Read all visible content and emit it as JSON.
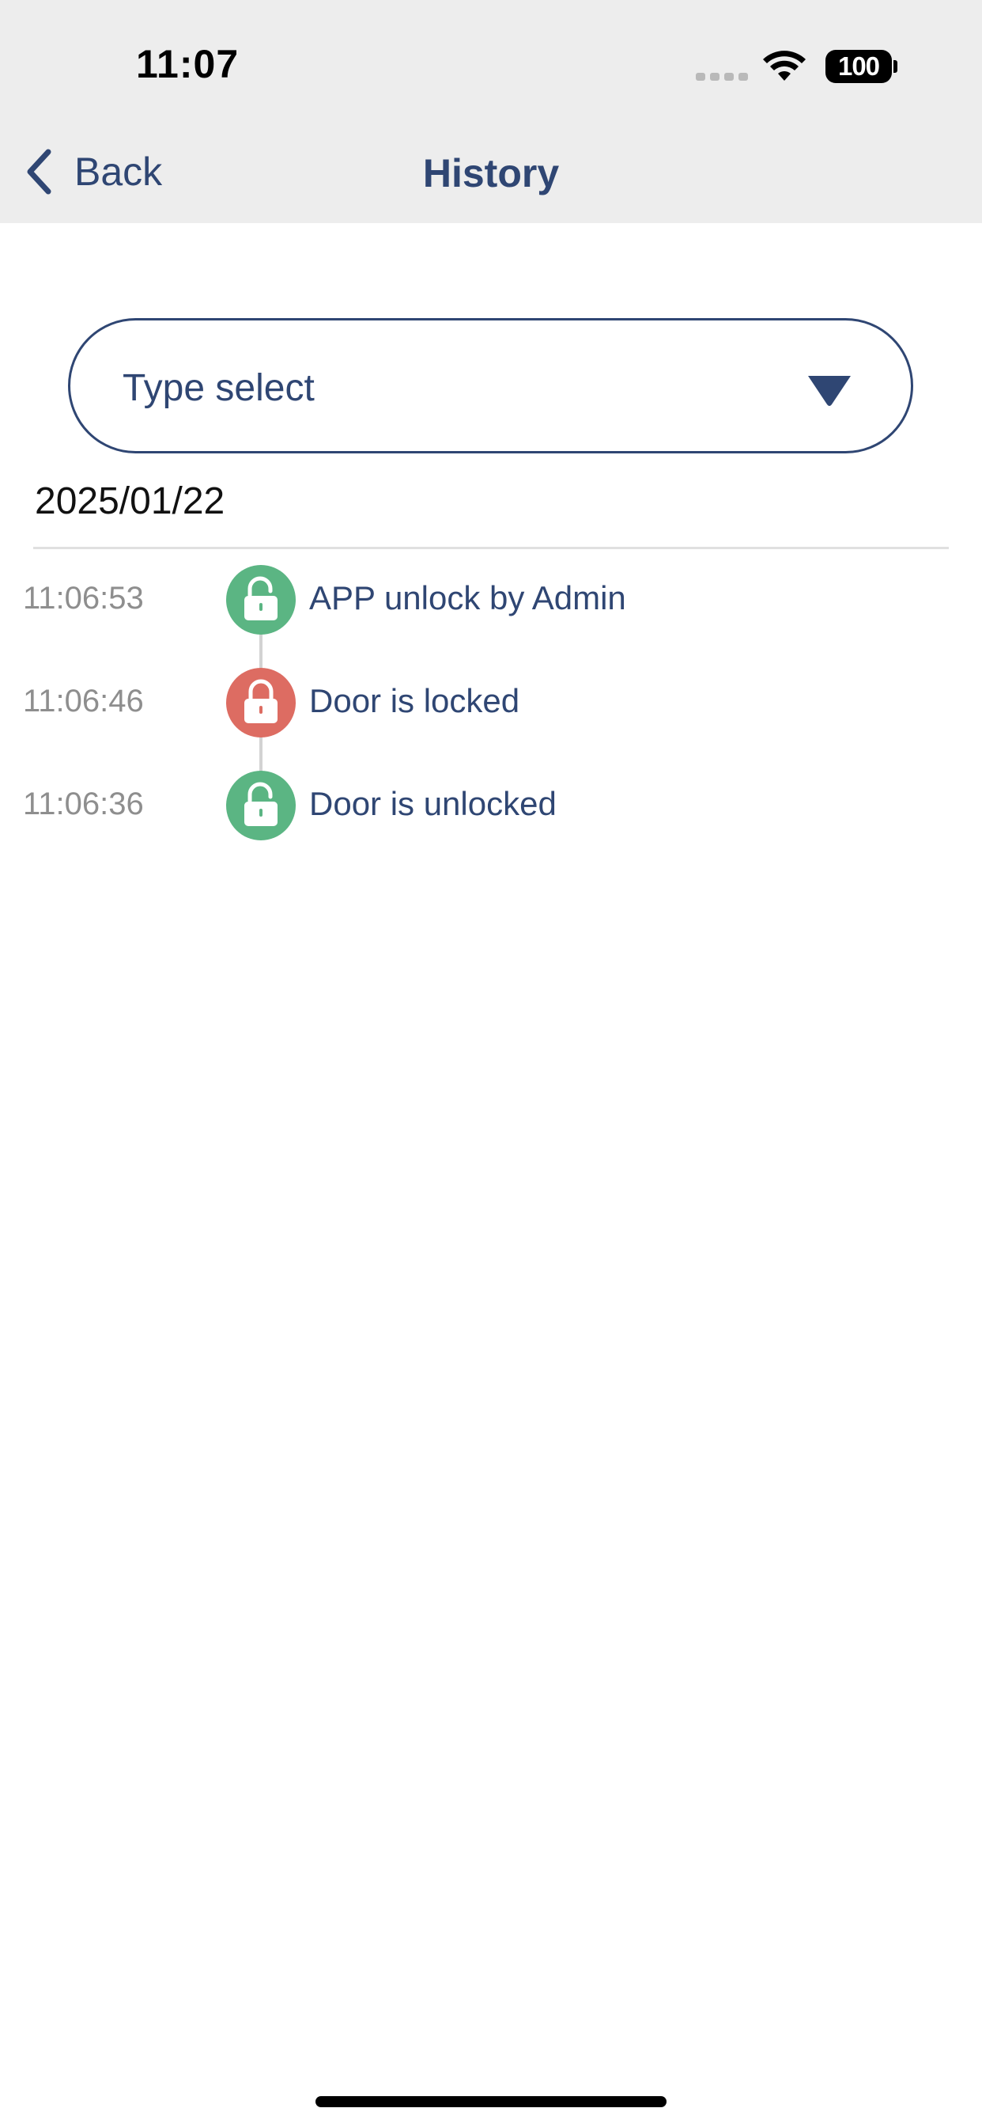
{
  "status_bar": {
    "time": "11:07",
    "battery": "100",
    "icons": [
      "signal-icon",
      "wifi-icon",
      "battery-icon"
    ]
  },
  "nav": {
    "back_label": "Back",
    "title": "History"
  },
  "filter": {
    "placeholder": "Type select"
  },
  "date": "2025/01/22",
  "colors": {
    "accent": "#2f4673",
    "unlocked": "#5bb583",
    "locked": "#dd6c62",
    "topbar_bg": "#ededed"
  },
  "events": [
    {
      "time": "11:06:53",
      "text": "APP unlock by Admin",
      "state": "unlocked",
      "icon": "unlock-icon"
    },
    {
      "time": "11:06:46",
      "text": "Door is locked",
      "state": "locked",
      "icon": "lock-icon"
    },
    {
      "time": "11:06:36",
      "text": "Door is unlocked",
      "state": "unlocked",
      "icon": "unlock-icon"
    }
  ]
}
